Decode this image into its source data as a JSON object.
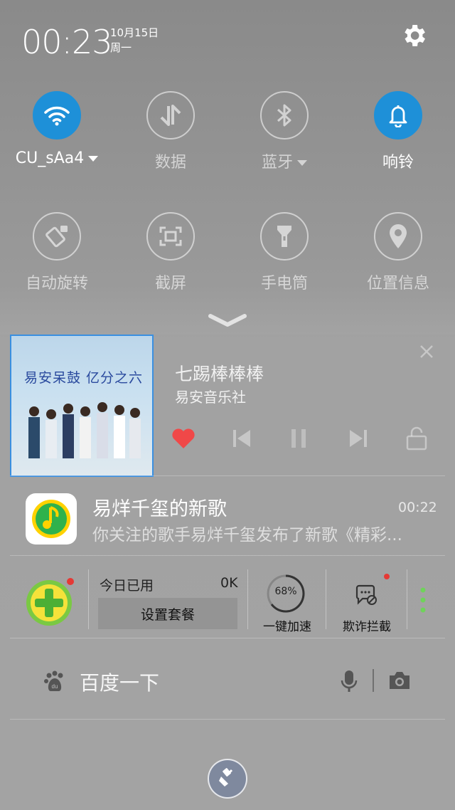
{
  "header": {
    "time": "00:23",
    "date": "10月15日",
    "weekday": "周一",
    "settings_icon": "gear-icon"
  },
  "toggles": [
    {
      "label": "CU_sAa4",
      "icon": "wifi-icon",
      "active": true,
      "has_dropdown": true
    },
    {
      "label": "数据",
      "icon": "data-transfer-icon",
      "active": false,
      "has_dropdown": false
    },
    {
      "label": "蓝牙",
      "icon": "bluetooth-icon",
      "active": false,
      "has_dropdown": true
    },
    {
      "label": "响铃",
      "icon": "bell-icon",
      "active": true,
      "has_dropdown": false
    },
    {
      "label": "自动旋转",
      "icon": "auto-rotate-icon",
      "active": false
    },
    {
      "label": "截屏",
      "icon": "screenshot-icon",
      "active": false
    },
    {
      "label": "手电筒",
      "icon": "flashlight-icon",
      "active": false
    },
    {
      "label": "位置信息",
      "icon": "location-icon",
      "active": false
    }
  ],
  "music": {
    "album_art_text": "易安呆鼓 亿分之六",
    "song_title": "七踢棒棒棒",
    "artist": "易安音乐社",
    "liked": true,
    "accent_color": "#f04848"
  },
  "notification": {
    "app_icon": "qq-music-icon",
    "title": "易烊千玺的新歌",
    "time": "00:22",
    "body": "你关注的歌手易烊千玺发布了新歌《精彩..."
  },
  "widget360": {
    "logo_icon": "360-security-icon",
    "usage_label": "今日已用",
    "usage_value": "0K",
    "plan_button": "设置套餐",
    "speed_percent": "68%",
    "speed_label": "一键加速",
    "fraud_label": "欺诈拦截"
  },
  "search": {
    "placeholder": "百度一下",
    "paw_icon": "baidu-paw-icon",
    "mic_icon": "microphone-icon",
    "camera_icon": "camera-icon"
  },
  "clear_icon": "broom-icon"
}
